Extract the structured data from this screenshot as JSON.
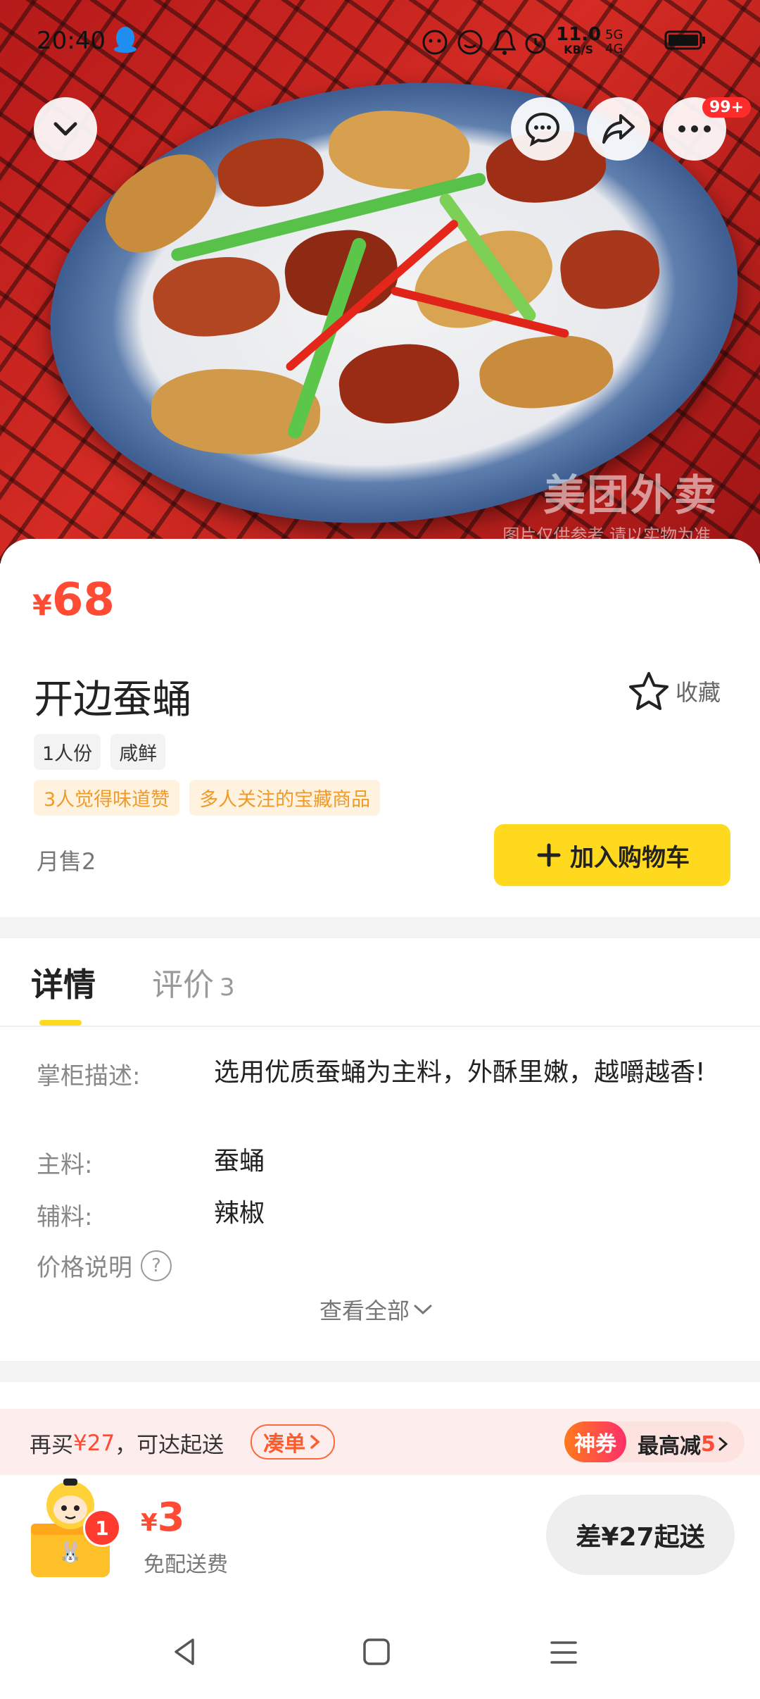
{
  "status_bar": {
    "time": "20:40",
    "speed_value": "11.0",
    "speed_unit": "KB/S",
    "network": "5G",
    "network2": "4G"
  },
  "hero": {
    "watermark": "美团外卖",
    "disclaimer": "图片仅供参考 请以实物为准",
    "more_badge": "99+"
  },
  "product": {
    "price_symbol": "¥",
    "price": "68",
    "name": "开边蚕蛹",
    "favorite_label": "收藏",
    "tags": [
      "1人份",
      "咸鲜"
    ],
    "highlight_tags": [
      "3人觉得味道赞",
      "多人关注的宝藏商品"
    ],
    "monthly_sales": "月售2",
    "add_to_cart_label": "加入购物车"
  },
  "tabs": {
    "details": "详情",
    "reviews": "评价",
    "reviews_count": "3"
  },
  "details": {
    "desc_label": "掌柜描述:",
    "desc_value": "选用优质蚕蛹为主料，外酥里嫩，越嚼越香!",
    "main_label": "主料:",
    "main_value": "蚕蛹",
    "aux_label": "辅料:",
    "aux_value": "辣椒",
    "price_note_label": "价格说明",
    "view_all": "查看全部"
  },
  "promo": {
    "prefix": "再买",
    "amount": "¥27",
    "suffix": "，可达起送",
    "cta": "凑单",
    "coupon_badge": "神券",
    "coupon_text": "最高减",
    "coupon_value": "5"
  },
  "cart": {
    "count": "1",
    "fee_symbol": "¥",
    "fee": "3",
    "fee_label": "免配送费",
    "checkout_label": "差¥27起送"
  },
  "colors": {
    "accent_red": "#ff4b33",
    "cart_yellow": "#ffd91d",
    "tag_orange": "#f09a2a"
  }
}
